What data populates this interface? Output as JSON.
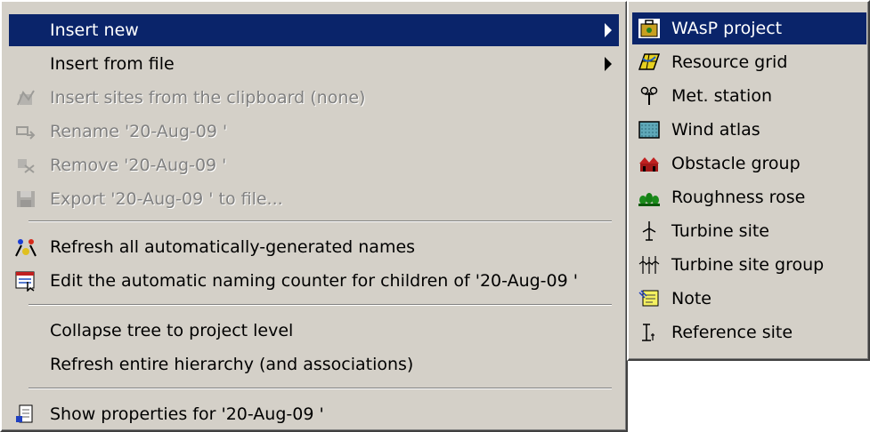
{
  "menu": {
    "items": [
      {
        "label": "Insert new",
        "icon": "none",
        "state": "selected",
        "submenu": true
      },
      {
        "label": "Insert from file",
        "icon": "none",
        "state": "enabled",
        "submenu": true
      },
      {
        "label": "Insert sites from the clipboard (none)",
        "icon": "clipboard-sites-icon",
        "state": "disabled"
      },
      {
        "label": "Rename '20-Aug-09 '",
        "icon": "rename-icon",
        "state": "disabled"
      },
      {
        "label": "Remove '20-Aug-09 '",
        "icon": "remove-icon",
        "state": "disabled"
      },
      {
        "label": "Export '20-Aug-09 ' to file...",
        "icon": "export-icon",
        "state": "disabled"
      },
      {
        "label": "Refresh all automatically-generated names",
        "icon": "refresh-names-icon",
        "state": "enabled"
      },
      {
        "label": "Edit the automatic naming counter for children of '20-Aug-09 '",
        "icon": "naming-counter-icon",
        "state": "enabled"
      },
      {
        "label": "Collapse tree to project level",
        "icon": "none",
        "state": "enabled"
      },
      {
        "label": "Refresh entire hierarchy (and associations)",
        "icon": "none",
        "state": "enabled"
      },
      {
        "label": "Show properties for '20-Aug-09 '",
        "icon": "properties-icon",
        "state": "enabled"
      }
    ]
  },
  "submenu": {
    "items": [
      {
        "label": "WAsP project",
        "icon": "wasp-project-icon",
        "state": "selected"
      },
      {
        "label": "Resource grid",
        "icon": "resource-grid-icon",
        "state": "enabled"
      },
      {
        "label": "Met. station",
        "icon": "met-station-icon",
        "state": "enabled"
      },
      {
        "label": "Wind atlas",
        "icon": "wind-atlas-icon",
        "state": "enabled"
      },
      {
        "label": "Obstacle group",
        "icon": "obstacle-group-icon",
        "state": "enabled"
      },
      {
        "label": "Roughness rose",
        "icon": "roughness-rose-icon",
        "state": "enabled"
      },
      {
        "label": "Turbine site",
        "icon": "turbine-site-icon",
        "state": "enabled"
      },
      {
        "label": "Turbine site group",
        "icon": "turbine-site-group-icon",
        "state": "enabled"
      },
      {
        "label": "Note",
        "icon": "note-icon",
        "state": "enabled"
      },
      {
        "label": "Reference site",
        "icon": "reference-site-icon",
        "state": "enabled"
      }
    ]
  },
  "colors": {
    "menu_bg": "#d4d0c8",
    "highlight": "#0a246a",
    "disabled_text": "#808080"
  }
}
